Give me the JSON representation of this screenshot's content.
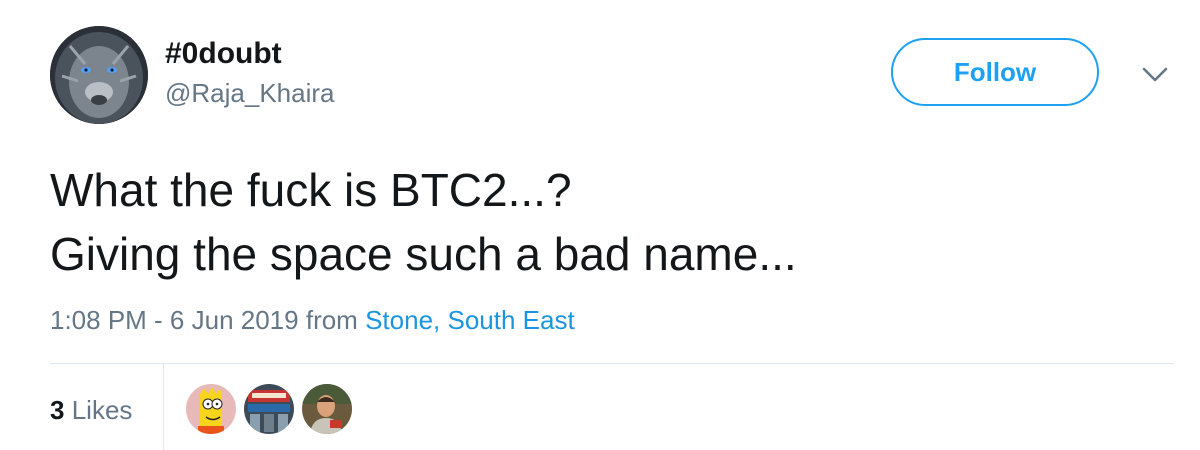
{
  "user": {
    "display_name": "#0doubt",
    "handle": "@Raja_Khaira",
    "avatar_icon": "lion-face-avatar"
  },
  "follow_button": {
    "label": "Follow"
  },
  "menu": {
    "icon": "chevron-down-icon"
  },
  "tweet": {
    "lines": [
      "What the fuck is BTC2...?",
      "Giving the space such a bad name..."
    ]
  },
  "meta": {
    "timestamp": "1:08 PM - 6 Jun 2019",
    "from_text": "from",
    "location": "Stone, South East"
  },
  "likes": {
    "count": "3",
    "label": "Likes",
    "likers": [
      "cartoon-avatar",
      "storefront-avatar",
      "person-avatar"
    ]
  },
  "colors": {
    "accent": "#1da1f2",
    "link": "#1b95e0",
    "secondary_text": "#657786",
    "divider": "#e1e8ed"
  }
}
